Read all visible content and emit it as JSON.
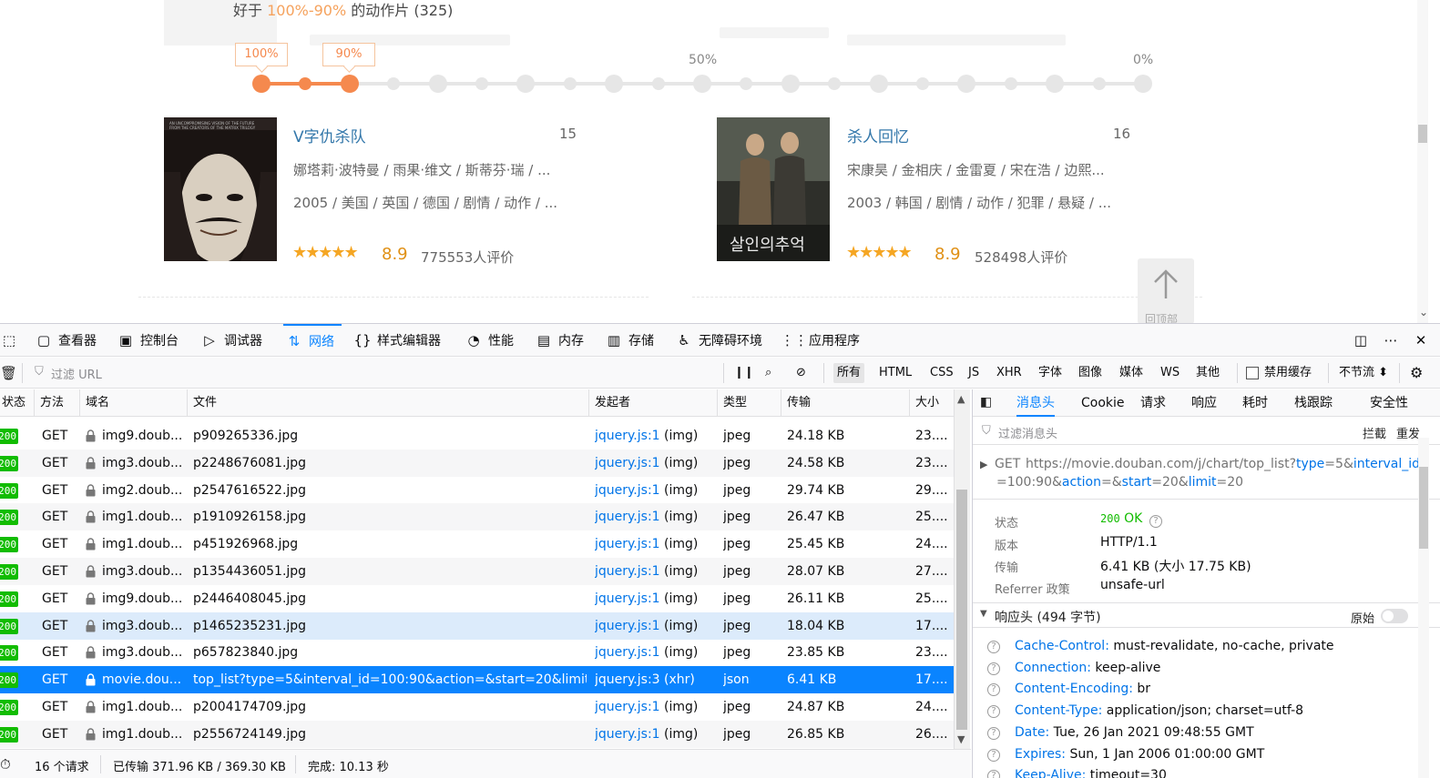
{
  "page": {
    "heading_prefix": "好于",
    "heading_range": "100%-90%",
    "heading_suffix": "的动作片 (325)",
    "range_tags": [
      "100%",
      "90%"
    ],
    "range_labels": [
      "50%",
      "0%"
    ],
    "range_selected": [
      1.0,
      0.9
    ],
    "back_to_top": "回顶部",
    "movies": [
      {
        "title": "V字仇杀队",
        "rank": "15",
        "cast": "娜塔莉·波特曼 / 雨果·维文 / 斯蒂芬·瑞 / ...",
        "meta": "2005 / 美国 / 英国 / 德国 / 剧情 / 动作 / ...",
        "stars": "★★★★★",
        "score": "8.9",
        "votes": "775553人评价"
      },
      {
        "title": "杀人回忆",
        "rank": "16",
        "cast": "宋康昊 / 金相庆 / 金雷夏 / 宋在浩 / 边熙...",
        "meta": "2003 / 韩国 / 剧情 / 动作 / 犯罪 / 悬疑 / ...",
        "stars": "★★★★★",
        "score": "8.9",
        "votes": "528498人评价"
      }
    ]
  },
  "devtools": {
    "tabs": [
      "查看器",
      "控制台",
      "调试器",
      "网络",
      "样式编辑器",
      "性能",
      "内存",
      "存储",
      "无障碍环境",
      "应用程序"
    ],
    "filter_placeholder": "过滤 URL",
    "type_filters": [
      "所有",
      "HTML",
      "CSS",
      "JS",
      "XHR",
      "字体",
      "图像",
      "媒体",
      "WS",
      "其他"
    ],
    "disable_cache": "禁用缓存",
    "throttle": "不节流 ⬍",
    "columns": [
      "状态",
      "方法",
      "域名",
      "文件",
      "发起者",
      "类型",
      "传输",
      "大小"
    ],
    "rows": [
      {
        "status": "200",
        "method": "GET",
        "domain": "img9.doub...",
        "file": "p909265336.jpg",
        "initiator": "jquery.js:1",
        "cause": "(img)",
        "type": "jpeg",
        "transferred": "24.18 KB",
        "size": "23...."
      },
      {
        "status": "200",
        "method": "GET",
        "domain": "img3.doub...",
        "file": "p2248676081.jpg",
        "initiator": "jquery.js:1",
        "cause": "(img)",
        "type": "jpeg",
        "transferred": "24.58 KB",
        "size": "23...."
      },
      {
        "status": "200",
        "method": "GET",
        "domain": "img2.doub...",
        "file": "p2547616522.jpg",
        "initiator": "jquery.js:1",
        "cause": "(img)",
        "type": "jpeg",
        "transferred": "29.74 KB",
        "size": "29...."
      },
      {
        "status": "200",
        "method": "GET",
        "domain": "img1.doub...",
        "file": "p1910926158.jpg",
        "initiator": "jquery.js:1",
        "cause": "(img)",
        "type": "jpeg",
        "transferred": "26.47 KB",
        "size": "25...."
      },
      {
        "status": "200",
        "method": "GET",
        "domain": "img1.doub...",
        "file": "p451926968.jpg",
        "initiator": "jquery.js:1",
        "cause": "(img)",
        "type": "jpeg",
        "transferred": "25.45 KB",
        "size": "24...."
      },
      {
        "status": "200",
        "method": "GET",
        "domain": "img3.doub...",
        "file": "p1354436051.jpg",
        "initiator": "jquery.js:1",
        "cause": "(img)",
        "type": "jpeg",
        "transferred": "28.07 KB",
        "size": "27...."
      },
      {
        "status": "200",
        "method": "GET",
        "domain": "img9.doub...",
        "file": "p2446408045.jpg",
        "initiator": "jquery.js:1",
        "cause": "(img)",
        "type": "jpeg",
        "transferred": "26.11 KB",
        "size": "25...."
      },
      {
        "status": "200",
        "method": "GET",
        "domain": "img3.doub...",
        "file": "p1465235231.jpg",
        "initiator": "jquery.js:1",
        "cause": "(img)",
        "type": "jpeg",
        "transferred": "18.04 KB",
        "size": "17...."
      },
      {
        "status": "200",
        "method": "GET",
        "domain": "img3.doub...",
        "file": "p657823840.jpg",
        "initiator": "jquery.js:1",
        "cause": "(img)",
        "type": "jpeg",
        "transferred": "23.85 KB",
        "size": "23...."
      },
      {
        "status": "200",
        "method": "GET",
        "domain": "movie.dou...",
        "file": "top_list?type=5&interval_id=100:90&action=&start=20&limit=20",
        "initiator": "jquery.js:3",
        "cause": "(xhr)",
        "type": "json",
        "transferred": "6.41 KB",
        "size": "17...."
      },
      {
        "status": "200",
        "method": "GET",
        "domain": "img1.doub...",
        "file": "p2004174709.jpg",
        "initiator": "jquery.js:1",
        "cause": "(img)",
        "type": "jpeg",
        "transferred": "24.87 KB",
        "size": "24...."
      },
      {
        "status": "200",
        "method": "GET",
        "domain": "img1.doub...",
        "file": "p2556724149.jpg",
        "initiator": "jquery.js:1",
        "cause": "(img)",
        "type": "jpeg",
        "transferred": "26.85 KB",
        "size": "26...."
      }
    ],
    "status_bar": {
      "requests": "16 个请求",
      "transferred": "已传输 371.96 KB / 369.30 KB",
      "finish": "完成: 10.13 秒"
    },
    "side": {
      "tabs": [
        "消息头",
        "Cookie",
        "请求",
        "响应",
        "耗时",
        "栈跟踪",
        "安全性"
      ],
      "filter_placeholder": "过滤消息头",
      "block_label": "拦截",
      "resend_label": "重发",
      "request_method": "GET",
      "url_base": "https://movie.douban.com/j/chart/top_list?",
      "url_p1_key": "type",
      "url_p1_val": "5&",
      "url_p2_key": "interval_id",
      "url_p2_val": "=100:90&",
      "url_p3_key": "action",
      "url_p3_val": "=&",
      "url_p4_key": "start",
      "url_p4_val": "=20&",
      "url_p5_key": "limit",
      "url_p5_val": "=20",
      "summary": [
        {
          "key": "状态",
          "value": "200"
        },
        {
          "key": "版本",
          "value": "HTTP/1.1"
        },
        {
          "key": "传输",
          "value": "6.41 KB (大小 17.75 KB)"
        },
        {
          "key": "Referrer 政策",
          "value": "unsafe-url"
        }
      ],
      "status_text": "OK",
      "response_headers_title": "响应头 (494 字节)",
      "raw_label": "原始",
      "headers": [
        {
          "name": "Cache-Control:",
          "value": "must-revalidate, no-cache, private"
        },
        {
          "name": "Connection:",
          "value": "keep-alive"
        },
        {
          "name": "Content-Encoding:",
          "value": "br"
        },
        {
          "name": "Content-Type:",
          "value": "application/json; charset=utf-8"
        },
        {
          "name": "Date:",
          "value": "Tue, 26 Jan 2021 09:48:55 GMT"
        },
        {
          "name": "Expires:",
          "value": "Sun, 1 Jan 2006 01:00:00 GMT"
        },
        {
          "name": "Keep-Alive:",
          "value": "timeout=30"
        }
      ]
    }
  },
  "colors": {
    "accent": "#0a84ff",
    "orange": "#f5894e",
    "status_ok": "#12bc00",
    "link": "#0074e8"
  }
}
